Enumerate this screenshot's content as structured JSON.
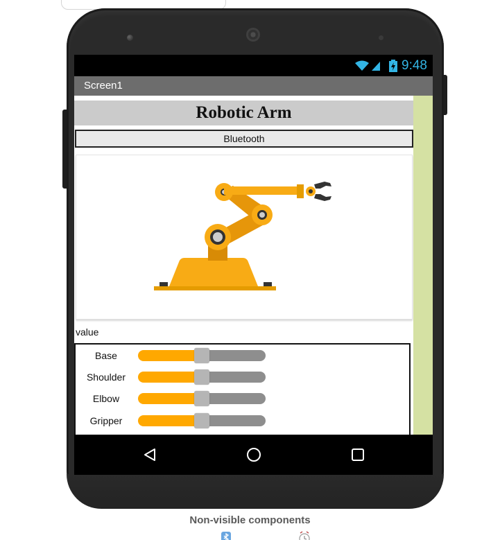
{
  "screen": {
    "title": "Screen1",
    "status_time": "9:48"
  },
  "app": {
    "title": "Robotic Arm",
    "bluetooth_button": "Bluetooth",
    "value_label": "value",
    "image_description": "robotic-arm-illustration",
    "sliders": [
      {
        "label": "Base",
        "value": 0.5
      },
      {
        "label": "Shoulder",
        "value": 0.5
      },
      {
        "label": "Elbow",
        "value": 0.5
      },
      {
        "label": "Gripper",
        "value": 0.5
      }
    ]
  },
  "footer": {
    "nonvisible_label": "Non-visible components"
  },
  "colors": {
    "accent_orange": "#ffa800",
    "scroll_track": "#d5e1a3",
    "status_blue": "#33b5e5",
    "title_bar": "#6d6d6d"
  },
  "icons": {
    "wifi": "wifi-icon",
    "signal": "signal-icon",
    "battery": "battery-icon",
    "nav_back": "back-triangle-icon",
    "nav_home": "home-circle-icon",
    "nav_recent": "recent-square-icon",
    "nonvisible_1": "bluetooth-client-icon",
    "nonvisible_2": "clock-icon"
  }
}
